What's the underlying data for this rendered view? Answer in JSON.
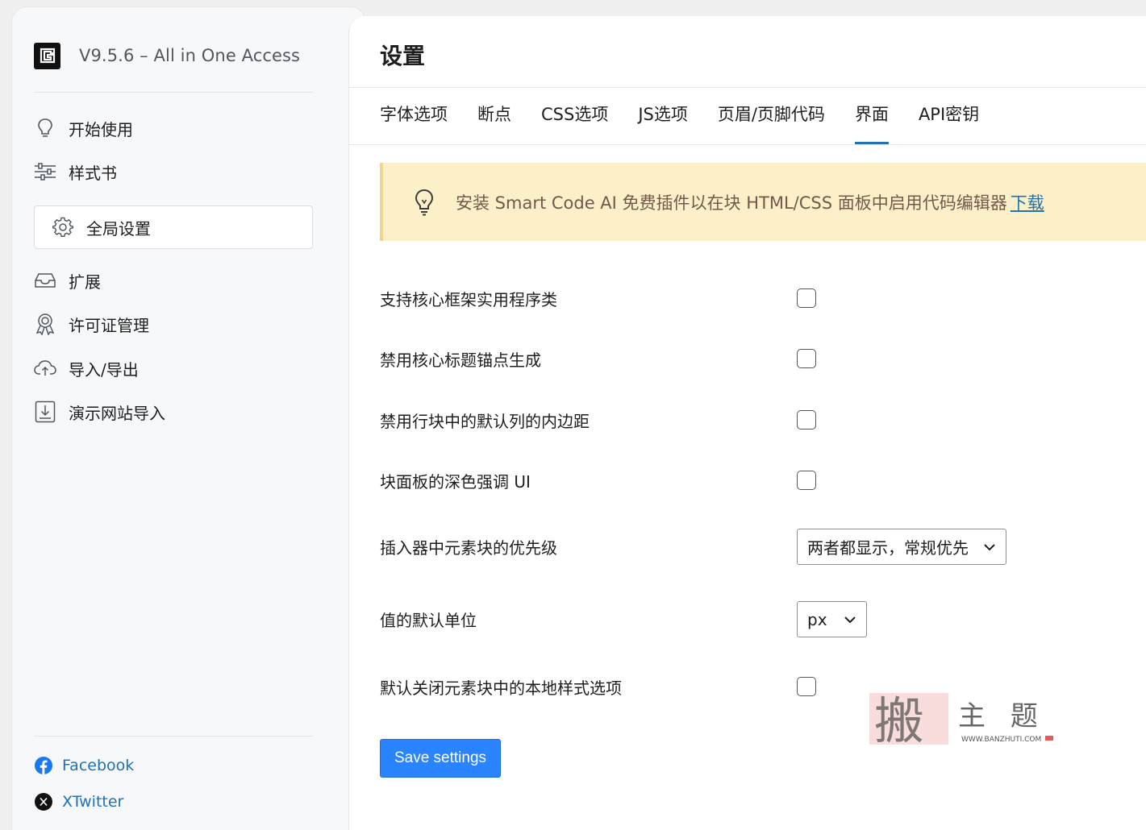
{
  "brand": {
    "title": "V9.5.6 – All in One Access"
  },
  "sidebar": {
    "items": [
      {
        "label": "开始使用"
      },
      {
        "label": "样式书"
      },
      {
        "label": "全局设置"
      },
      {
        "label": "扩展"
      },
      {
        "label": "许可证管理"
      },
      {
        "label": "导入/导出"
      },
      {
        "label": "演示网站导入"
      }
    ],
    "social": [
      {
        "label": "Facebook"
      },
      {
        "label": "XTwitter"
      }
    ]
  },
  "main": {
    "title": "设置",
    "tabs": [
      {
        "label": "字体选项"
      },
      {
        "label": "断点"
      },
      {
        "label": "CSS选项"
      },
      {
        "label": "JS选项"
      },
      {
        "label": "页眉/页脚代码"
      },
      {
        "label": "界面"
      },
      {
        "label": "API密钥"
      }
    ],
    "notice": {
      "text": "安装 Smart Code AI 免费插件以在块 HTML/CSS 面板中启用代码编辑器",
      "link": "下载"
    },
    "settings": [
      {
        "label": "支持核心框架实用程序类"
      },
      {
        "label": "禁用核心标题锚点生成"
      },
      {
        "label": "禁用行块中的默认列的内边距"
      },
      {
        "label": "块面板的深色强调 UI"
      },
      {
        "label": "插入器中元素块的优先级",
        "value": "两者都显示，常规优先"
      },
      {
        "label": "值的默认单位",
        "value": "px"
      },
      {
        "label": "默认关闭元素块中的本地样式选项"
      }
    ],
    "save_label": "Save settings"
  },
  "watermark": {
    "text": "搬 主 题",
    "url": "WWW.BANZHUTI.COM"
  }
}
